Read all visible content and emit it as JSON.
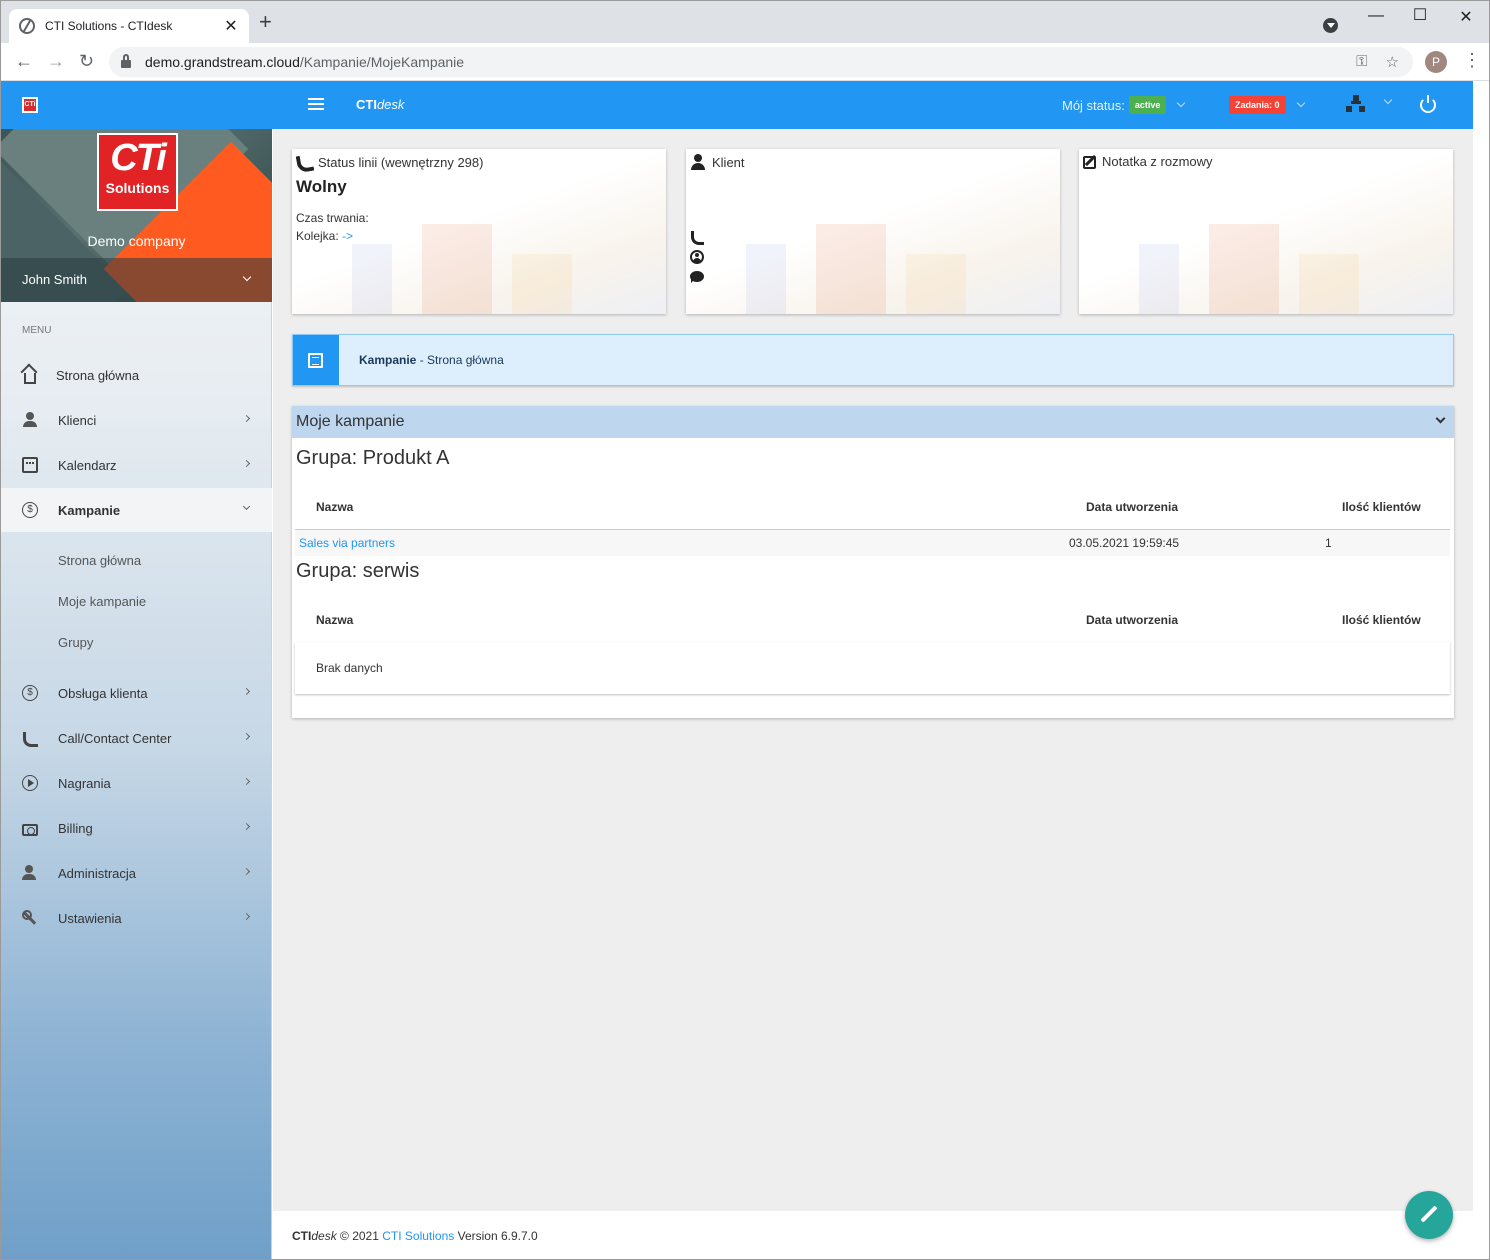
{
  "browser": {
    "tab_title": "CTI Solutions - CTIdesk",
    "url_host": "demo.grandstream.cloud",
    "url_path": "/Kampanie/MojeKampanie",
    "profile_initial": "P"
  },
  "header": {
    "brand_bold": "CTI",
    "brand_italic": "desk",
    "status_label": "Mój status:",
    "status_value": "active",
    "tasks_label": "Zadania: 0",
    "logo_text": "CTi"
  },
  "sidebar": {
    "logo_big": "CTi",
    "logo_small": "Solutions",
    "company": "Demo company",
    "user": "John Smith",
    "menu_label": "MENU",
    "items": [
      {
        "label": "Strona główna",
        "icon": "home-icon"
      },
      {
        "label": "Klienci",
        "icon": "user-icon"
      },
      {
        "label": "Kalendarz",
        "icon": "calendar-icon"
      },
      {
        "label": "Kampanie",
        "icon": "dollar-coin-icon"
      },
      {
        "label": "Obsługa klienta",
        "icon": "dollar-coin-icon"
      },
      {
        "label": "Call/Contact Center",
        "icon": "phone-icon"
      },
      {
        "label": "Nagrania",
        "icon": "play-icon"
      },
      {
        "label": "Billing",
        "icon": "money-icon"
      },
      {
        "label": "Administracja",
        "icon": "admin-icon"
      },
      {
        "label": "Ustawienia",
        "icon": "wrench-icon"
      }
    ],
    "subitems": [
      "Strona główna",
      "Moje kampanie",
      "Grupy"
    ]
  },
  "cards": {
    "line_status": {
      "title": "Status linii (wewnętrzny 298)",
      "state": "Wolny",
      "duration_label": "Czas trwania:",
      "queue_label": "Kolejka:",
      "queue_link": "->"
    },
    "client": {
      "title": "Klient"
    },
    "note": {
      "title": "Notatka z rozmowy"
    }
  },
  "breadcrumb": {
    "section": "Kampanie",
    "separator": " - ",
    "page": "Strona główna"
  },
  "panel": {
    "title": "Moje kampanie",
    "groups": [
      {
        "title": "Grupa: Produkt A",
        "headers": [
          "Nazwa",
          "Data utworzenia",
          "Ilość klientów"
        ],
        "rows": [
          {
            "name": "Sales via partners",
            "date": "03.05.2021 19:59:45",
            "count": "1"
          }
        ]
      },
      {
        "title": "Grupa: serwis",
        "headers": [
          "Nazwa",
          "Data utworzenia",
          "Ilość klientów"
        ],
        "empty": "Brak danych"
      }
    ]
  },
  "footer": {
    "brand_bold": "CTI",
    "brand_italic": "desk",
    "copyright": " © 2021 ",
    "company_link": "CTI Solutions",
    "version": " Version 6.9.7.0"
  },
  "colors": {
    "primary": "#2196f3",
    "status_active": "#4caf50",
    "tasks_badge": "#f44336",
    "fab": "#26a69a"
  }
}
